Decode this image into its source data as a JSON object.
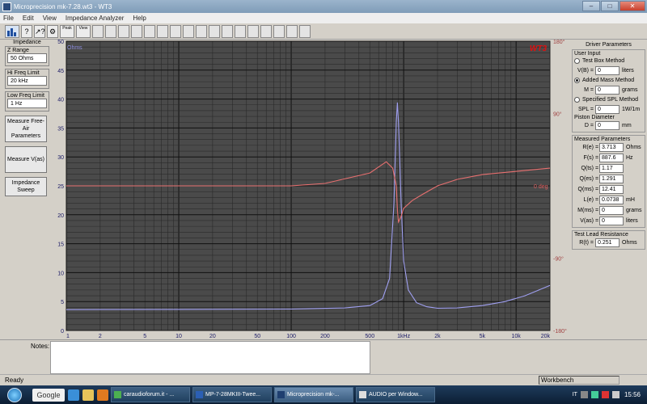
{
  "window": {
    "title": "Microprecision mk-7.28.wt3 - WT3"
  },
  "menu": [
    "File",
    "Edit",
    "View",
    "Impedance Analyzer",
    "Help"
  ],
  "toolbar": {
    "peak_label": "Peak",
    "view_label": "View"
  },
  "left_panel": {
    "impedance_title": "Impedance",
    "z_range_label": "Z Range",
    "z_range_value": "50 Ohms",
    "hi_freq_label": "Hi Freq Limit",
    "hi_freq_value": "20 kHz",
    "low_freq_label": "Low Freq Limit",
    "low_freq_value": "1 Hz",
    "btn_free_air": "Measure Free-Air Parameters",
    "btn_vas": "Measure V(as)",
    "btn_sweep": "Impedance Sweep"
  },
  "chart_data": {
    "type": "line",
    "title": "",
    "logo": "WT3",
    "xscale": "log",
    "xlim": [
      1,
      20000
    ],
    "x_ticks": [
      "1",
      "2",
      "5",
      "10",
      "20",
      "50",
      "100",
      "200",
      "500",
      "1kHz",
      "2k",
      "5k",
      "10k",
      "20k"
    ],
    "x_tick_values": [
      1,
      2,
      5,
      10,
      20,
      50,
      100,
      200,
      500,
      1000,
      2000,
      5000,
      10000,
      20000
    ],
    "ylim": [
      0,
      50
    ],
    "ylabel": "Ohms",
    "y_ticks": [
      0,
      5,
      10,
      15,
      20,
      25,
      30,
      35,
      40,
      45,
      50
    ],
    "y2lim": [
      -180,
      180
    ],
    "y2_ticks": [
      {
        "label": "180°",
        "value": 180
      },
      {
        "label": "90°",
        "value": 90
      },
      {
        "label": "0 deg",
        "value": 0
      },
      {
        "label": "-90°",
        "value": -90
      },
      {
        "label": "-180°",
        "value": -180
      }
    ],
    "background": "#4a4a4a",
    "grid": true,
    "series": [
      {
        "color": "#9f9ff0",
        "axis": "left",
        "x": [
          1,
          10,
          100,
          300,
          500,
          650,
          750,
          820,
          860,
          880,
          900,
          950,
          1000,
          1100,
          1300,
          1600,
          2000,
          3000,
          5000,
          8000,
          12000,
          20000
        ],
        "values": [
          3.6,
          3.65,
          3.7,
          3.9,
          4.3,
          5.5,
          9.0,
          22.0,
          36.0,
          39.4,
          36.0,
          22.0,
          12.0,
          7.0,
          4.8,
          4.1,
          3.85,
          3.9,
          4.3,
          5.0,
          6.0,
          7.8
        ]
      },
      {
        "color": "#e87070",
        "axis": "right",
        "x": [
          1,
          10,
          100,
          200,
          500,
          700,
          800,
          860,
          880,
          900,
          950,
          1000,
          1200,
          1500,
          2000,
          3000,
          5000,
          10000,
          20000
        ],
        "values": [
          0,
          0,
          0,
          3,
          16,
          30,
          22,
          0,
          -30,
          -45,
          -38,
          -28,
          -18,
          -10,
          0,
          8,
          14,
          18,
          22
        ]
      }
    ]
  },
  "right_panel": {
    "title": "Driver Parameters",
    "user_input_title": "User Input",
    "opt_test_box": "Test Box Method",
    "vb_label": "V(B) =",
    "vb_value": "0",
    "vb_unit": "liters",
    "opt_added_mass": "Added Mass Method",
    "m_label": "M =",
    "m_value": "0",
    "m_unit": "grams",
    "opt_spl": "Specified SPL Method",
    "spl_label": "SPL =",
    "spl_value": "0",
    "spl_unit": "1W/1m",
    "piston_label": "Piston Diameter",
    "d_label": "D =",
    "d_value": "0",
    "d_unit": "mm",
    "measured_title": "Measured Parameters",
    "params": [
      {
        "k": "R(e)",
        "v": "3.713",
        "u": "Ohms"
      },
      {
        "k": "F(s)",
        "v": "887.6",
        "u": "Hz"
      },
      {
        "k": "Q(ts)",
        "v": "1.17",
        "u": ""
      },
      {
        "k": "Q(es)",
        "v": "1.291",
        "u": ""
      },
      {
        "k": "Q(ms)",
        "v": "12.41",
        "u": ""
      },
      {
        "k": "L(e)",
        "v": "0.0738",
        "u": "mH"
      },
      {
        "k": "M(ms)",
        "v": "0",
        "u": "grams"
      },
      {
        "k": "V(as)",
        "v": "0",
        "u": "liters"
      }
    ],
    "lead_title": "Test Lead Resistance",
    "rt_label": "R(t) =",
    "rt_value": "0.251",
    "rt_unit": "Ohms"
  },
  "notes_label": "Notes:",
  "status": {
    "text": "Ready",
    "panel": "Workbench"
  },
  "taskbar": {
    "google": "Google",
    "tasks": [
      "caraudioforum.it - ...",
      "MP-7-28MKIII-Twee...",
      "Microprecision mk-...",
      "AUDIO per Window..."
    ],
    "lang": "IT",
    "time": "15:56"
  }
}
